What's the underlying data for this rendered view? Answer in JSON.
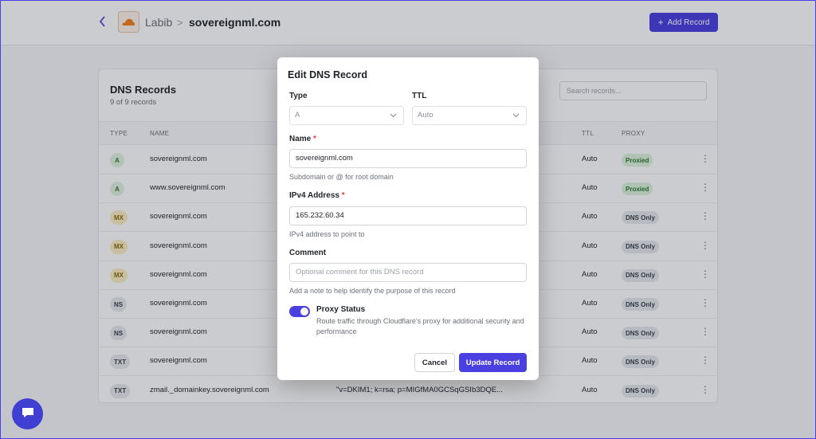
{
  "header": {
    "account": "Labib",
    "separator": ">",
    "domain": "sovereignml.com",
    "add_record_label": "Add Record"
  },
  "table": {
    "title": "DNS Records",
    "subtitle": "9 of 9 records",
    "search_placeholder": "Search records...",
    "columns": {
      "type": "TYPE",
      "name": "NAME",
      "ttl": "TTL",
      "proxy": "PROXY"
    },
    "rows": [
      {
        "type": "A",
        "name": "sovereignml.com",
        "content": "",
        "ttl": "Auto",
        "proxy": "Proxied"
      },
      {
        "type": "A",
        "name": "www.sovereignml.com",
        "content": "",
        "ttl": "Auto",
        "proxy": "Proxied"
      },
      {
        "type": "MX",
        "name": "sovereignml.com",
        "content": "",
        "ttl": "Auto",
        "proxy": "DNS Only"
      },
      {
        "type": "MX",
        "name": "sovereignml.com",
        "content": "",
        "ttl": "Auto",
        "proxy": "DNS Only"
      },
      {
        "type": "MX",
        "name": "sovereignml.com",
        "content": "",
        "ttl": "Auto",
        "proxy": "DNS Only"
      },
      {
        "type": "NS",
        "name": "sovereignml.com",
        "content": "",
        "ttl": "Auto",
        "proxy": "DNS Only"
      },
      {
        "type": "NS",
        "name": "sovereignml.com",
        "content": "",
        "ttl": "Auto",
        "proxy": "DNS Only"
      },
      {
        "type": "TXT",
        "name": "sovereignml.com",
        "content": "",
        "ttl": "Auto",
        "proxy": "DNS Only"
      },
      {
        "type": "TXT",
        "name": "zmail._domainkey.sovereignml.com",
        "content": "\"v=DKIM1; k=rsa; p=MIGfMA0GCSqGSIb3DQE...",
        "ttl": "Auto",
        "proxy": "DNS Only"
      }
    ]
  },
  "modal": {
    "title": "Edit DNS Record",
    "type_label": "Type",
    "type_value": "A",
    "ttl_label": "TTL",
    "ttl_value": "Auto",
    "name_label": "Name",
    "name_value": "sovereignml.com",
    "name_help": "Subdomain or @ for root domain",
    "ipv4_label": "IPv4 Address",
    "ipv4_value": "165.232.60.34",
    "ipv4_help": "IPv4 address to point to",
    "comment_label": "Comment",
    "comment_placeholder": "Optional comment for this DNS record",
    "comment_help": "Add a note to help identify the purpose of this record",
    "required_mark": "*",
    "proxy_label": "Proxy Status",
    "proxy_desc": "Route traffic through Cloudflare's proxy for additional security and performance",
    "proxy_enabled": true,
    "cancel_label": "Cancel",
    "update_label": "Update Record"
  },
  "colors": {
    "accent": "#4a3fe0",
    "proxied_bg": "#dcf3dc",
    "proxied_fg": "#2f7a2f",
    "a_bg": "#dff3e0",
    "a_fg": "#2f7a2f",
    "mx_bg": "#fbefc4",
    "mx_fg": "#8a6a10",
    "ns_bg": "#e6e8ec",
    "ns_fg": "#3d434c",
    "txt_bg": "#e6e8ec",
    "txt_fg": "#3d434c",
    "dnsonly_bg": "#e6e8ec",
    "dnsonly_fg": "#3d434c"
  },
  "icons": {
    "back": "chevron-left-icon",
    "logo": "cloudflare-logo-icon",
    "add": "plus-icon",
    "kebab": "more-vertical-icon",
    "chat": "chat-icon",
    "select": "chevron-down-icon"
  }
}
